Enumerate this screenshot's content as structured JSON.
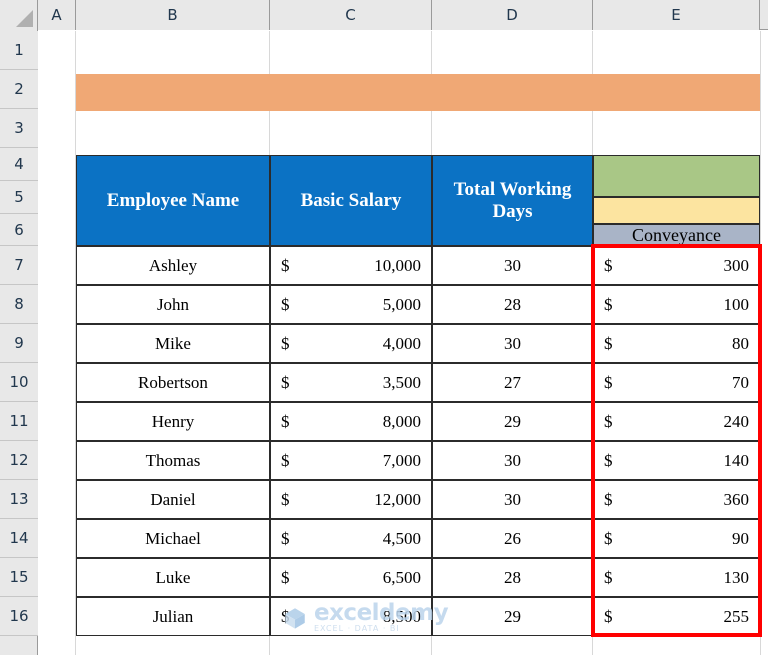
{
  "app": {
    "type": "spreadsheet",
    "column_headers": [
      "A",
      "B",
      "C",
      "D",
      "E"
    ],
    "row_headers": [
      "1",
      "2",
      "3",
      "4",
      "5",
      "6",
      "7",
      "8",
      "9",
      "10",
      "11",
      "12",
      "13",
      "14",
      "15",
      "16"
    ]
  },
  "banner": {
    "color": "#F0A875",
    "text": ""
  },
  "table": {
    "headers": {
      "employee_name": "Employee Name",
      "basic_salary": "Basic Salary",
      "total_working_days": "Total Working Days",
      "conveyance": "Conveyance"
    },
    "header_colors": {
      "blue": "#0B72C4",
      "green": "#A9C786",
      "yellow": "#FCE4A0",
      "gray": "#A9B4C7"
    },
    "currency_symbol": "$",
    "rows": [
      {
        "name": "Ashley",
        "salary": "10,000",
        "days": "30",
        "conveyance": "300"
      },
      {
        "name": "John",
        "salary": "5,000",
        "days": "28",
        "conveyance": "100"
      },
      {
        "name": "Mike",
        "salary": "4,000",
        "days": "30",
        "conveyance": "80"
      },
      {
        "name": "Robertson",
        "salary": "3,500",
        "days": "27",
        "conveyance": "70"
      },
      {
        "name": "Henry",
        "salary": "8,000",
        "days": "29",
        "conveyance": "240"
      },
      {
        "name": "Thomas",
        "salary": "7,000",
        "days": "30",
        "conveyance": "140"
      },
      {
        "name": "Daniel",
        "salary": "12,000",
        "days": "30",
        "conveyance": "360"
      },
      {
        "name": "Michael",
        "salary": "4,500",
        "days": "26",
        "conveyance": "90"
      },
      {
        "name": "Luke",
        "salary": "6,500",
        "days": "28",
        "conveyance": "130"
      },
      {
        "name": "Julian",
        "salary": "8,500",
        "days": "29",
        "conveyance": "255"
      }
    ]
  },
  "selection": {
    "highlight_color": "#FF0000"
  },
  "watermark": {
    "main": "exceldemy",
    "sub": "EXCEL · DATA · BI"
  }
}
